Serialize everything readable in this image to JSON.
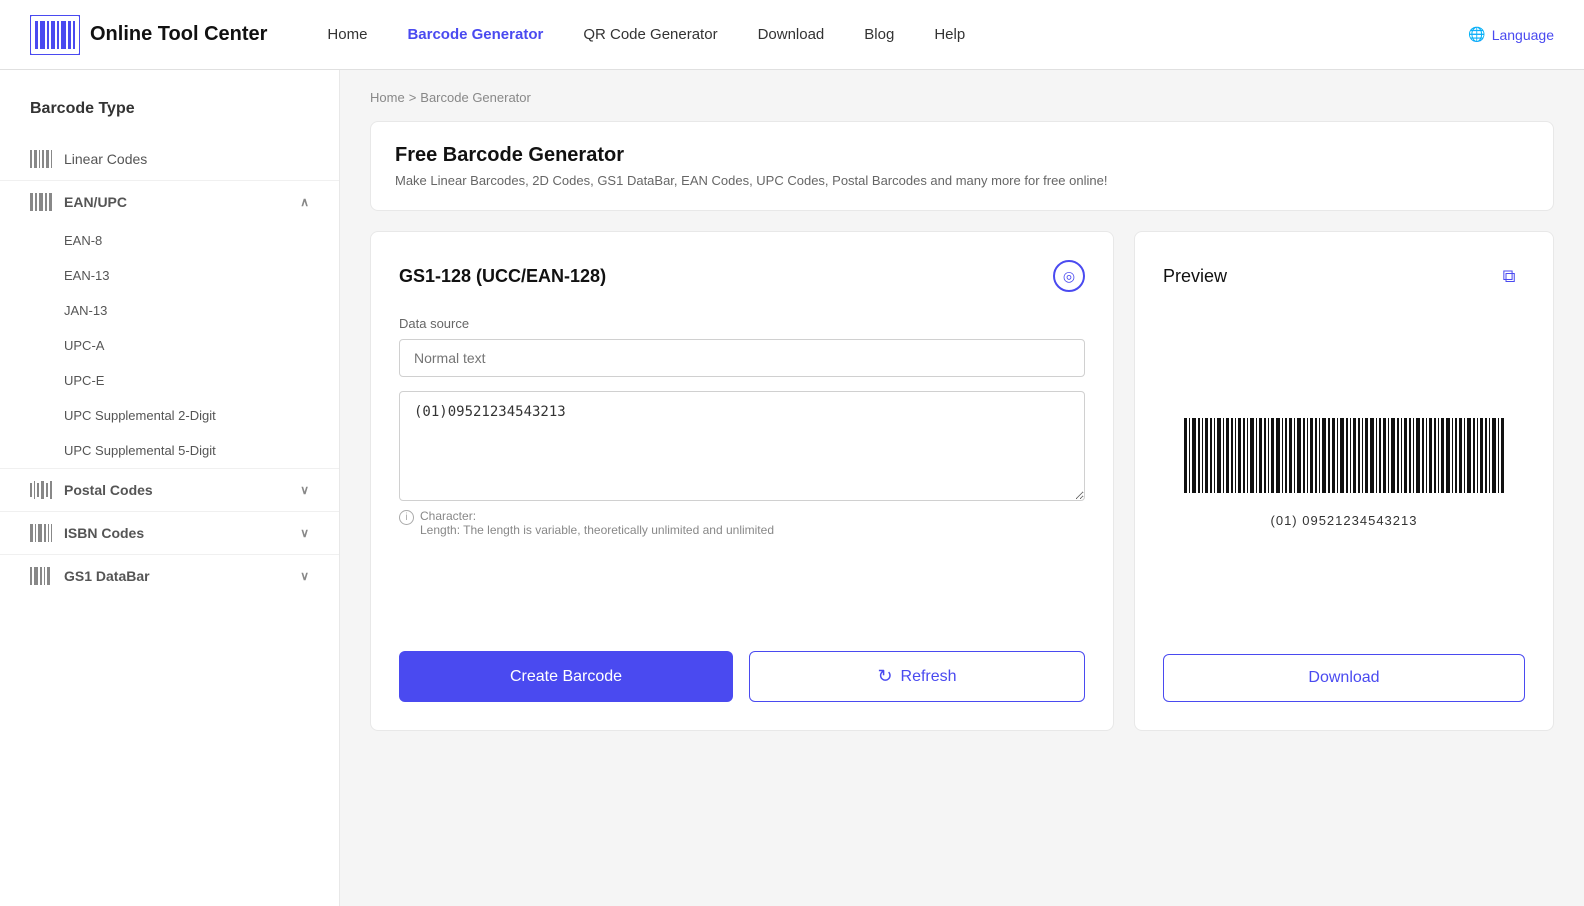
{
  "header": {
    "logo_text": "Online Tool Center",
    "nav": [
      {
        "label": "Home",
        "active": false,
        "id": "home"
      },
      {
        "label": "Barcode Generator",
        "active": true,
        "id": "barcode-generator"
      },
      {
        "label": "QR Code Generator",
        "active": false,
        "id": "qr-code-generator"
      },
      {
        "label": "Download",
        "active": false,
        "id": "download"
      },
      {
        "label": "Blog",
        "active": false,
        "id": "blog"
      },
      {
        "label": "Help",
        "active": false,
        "id": "help"
      }
    ],
    "language_label": "Language"
  },
  "sidebar": {
    "title": "Barcode Type",
    "items": [
      {
        "label": "Linear Codes",
        "active": false,
        "id": "linear-codes"
      },
      {
        "label": "EAN/UPC",
        "active": false,
        "id": "ean-upc",
        "expanded": true,
        "sub": [
          {
            "label": "EAN-8"
          },
          {
            "label": "EAN-13"
          },
          {
            "label": "JAN-13"
          },
          {
            "label": "UPC-A"
          },
          {
            "label": "UPC-E"
          },
          {
            "label": "UPC Supplemental 2-Digit"
          },
          {
            "label": "UPC Supplemental 5-Digit"
          }
        ]
      },
      {
        "label": "Postal Codes",
        "active": false,
        "id": "postal-codes",
        "expanded": false
      },
      {
        "label": "ISBN Codes",
        "active": false,
        "id": "isbn-codes",
        "expanded": false
      },
      {
        "label": "GS1 DataBar",
        "active": false,
        "id": "gs1-databar",
        "expanded": false
      }
    ]
  },
  "breadcrumb": {
    "home": "Home",
    "sep": ">",
    "current": "Barcode Generator"
  },
  "hero": {
    "title": "Free Barcode Generator",
    "description": "Make Linear Barcodes, 2D Codes, GS1 DataBar, EAN Codes, UPC Codes, Postal Barcodes and many more for free online!"
  },
  "generator": {
    "title": "GS1-128 (UCC/EAN-128)",
    "data_source_label": "Data source",
    "data_source_placeholder": "Normal text",
    "barcode_value": "(01)09521234543213",
    "char_info_label": "Character:",
    "char_info_detail": "Length: The length is variable, theoretically unlimited and unlimited",
    "create_label": "Create Barcode",
    "refresh_label": "Refresh"
  },
  "preview": {
    "title": "Preview",
    "barcode_text": "(01) 09521234543213",
    "download_label": "Download"
  },
  "icons": {
    "barcode_small": "|||",
    "chevron_down": "∨",
    "chevron_up": "∧",
    "globe": "🌐",
    "refresh": "↻",
    "copy": "⧉",
    "info": "ℹ"
  }
}
